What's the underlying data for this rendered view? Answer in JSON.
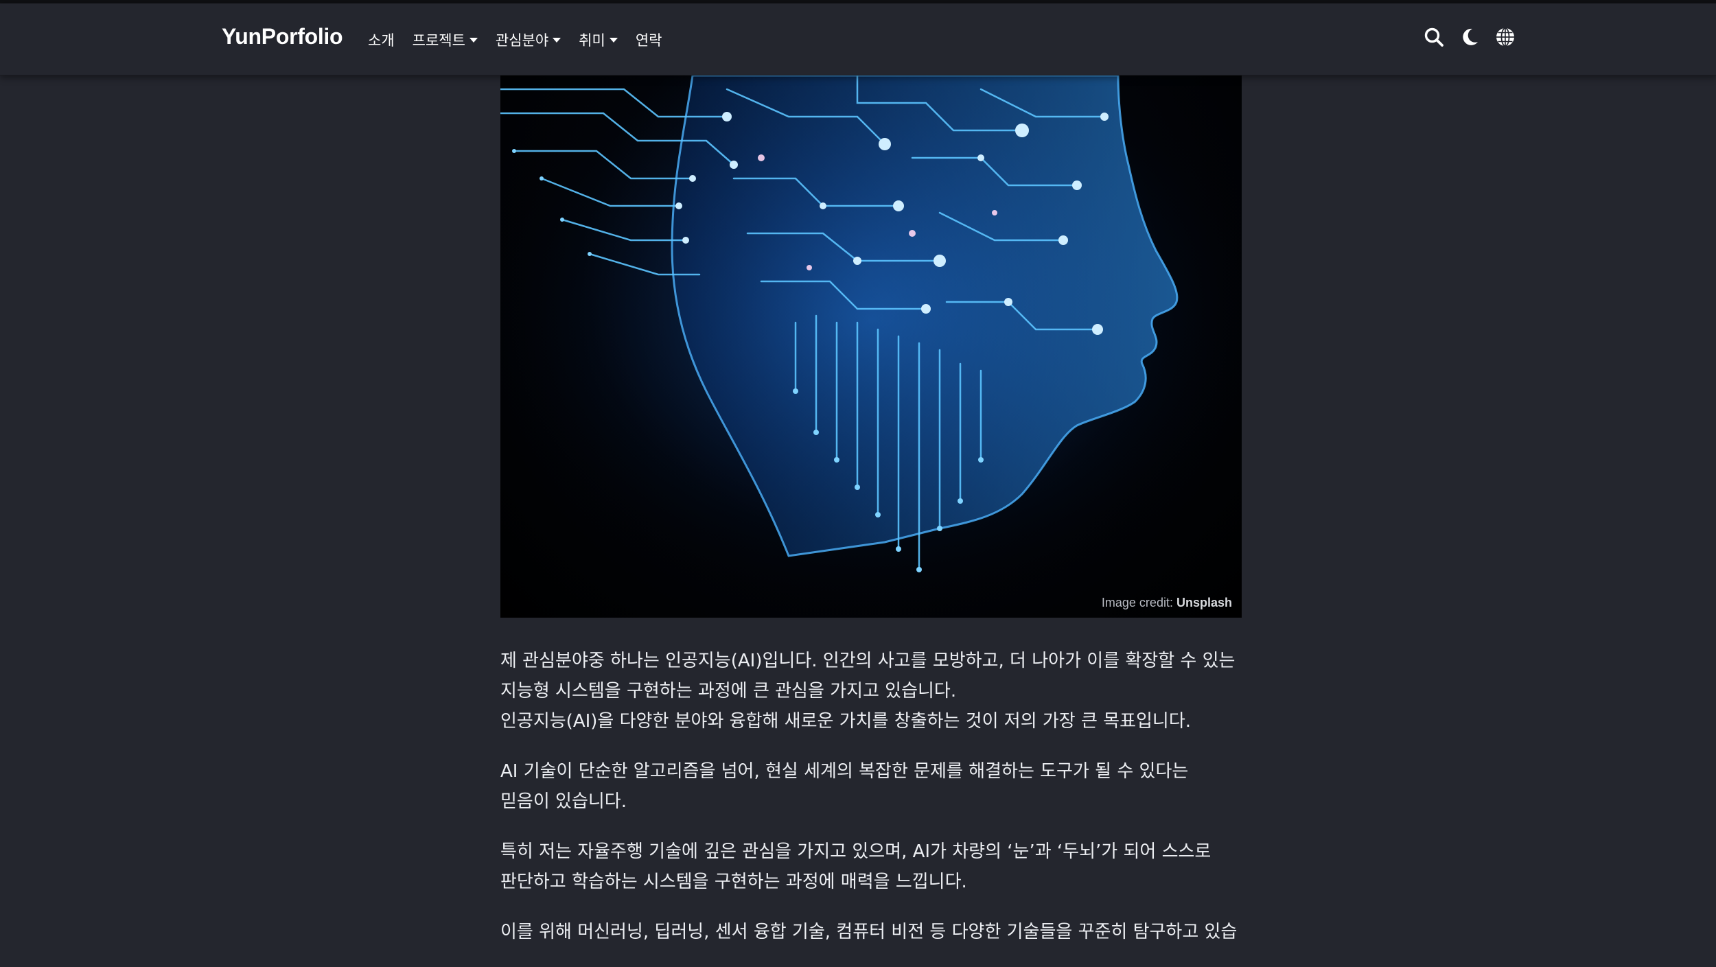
{
  "navbar": {
    "brand": "YunPorfolio",
    "items": [
      {
        "label": "소개",
        "dropdown": false
      },
      {
        "label": "프로젝트",
        "dropdown": true
      },
      {
        "label": "관심분야",
        "dropdown": true
      },
      {
        "label": "취미",
        "dropdown": true
      },
      {
        "label": "연락",
        "dropdown": false
      }
    ],
    "icons": [
      "search-icon",
      "moon-icon",
      "globe-icon"
    ]
  },
  "hero": {
    "credit_prefix": "Image credit:",
    "credit_source": "Unsplash"
  },
  "article": {
    "p1_line1": "제 관심분야중 하나는 인공지능(AI)입니다. 인간의 사고를 모방하고, 더 나아가 이를 확장할 수 있는 지능형 시스템을 구현하는 과정에 큰 관심을 가지고 있습니다.",
    "p1_line2": "인공지능(AI)을 다양한 분야와 융합해 새로운 가치를 창출하는 것이 저의 가장 큰 목표입니다.",
    "p2": "AI 기술이 단순한 알고리즘을 넘어, 현실 세계의 복잡한 문제를 해결하는 도구가 될 수 있다는 믿음이 있습니다.",
    "p3": "특히 저는 자율주행 기술에 깊은 관심을 가지고 있으며, AI가 차량의 ‘눈’과 ‘두뇌’가 되어 스스로 판단하고 학습하는 시스템을 구현하는 과정에 매력을 느낍니다.",
    "p4": "이를 위해 머신러닝, 딥러닝, 센서 융합 기술, 컴퓨터 비전 등 다양한 기술들을 꾸준히 탐구하고 있습"
  },
  "colors": {
    "background": "#24262e",
    "navbar": "#24262e",
    "text": "#eceef2",
    "hero_glow": "#1e90ff"
  }
}
